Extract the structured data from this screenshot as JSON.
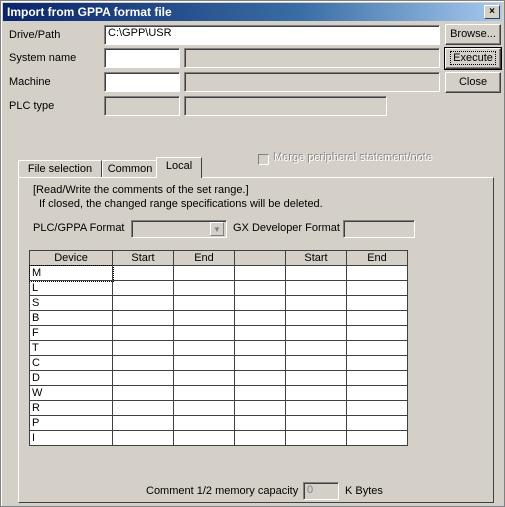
{
  "window": {
    "title": "Import from GPPA format file",
    "close_glyph": "×"
  },
  "labels": {
    "drive_path": "Drive/Path",
    "system_name": "System name",
    "machine": "Machine",
    "plc_type": "PLC type"
  },
  "fields": {
    "drive_path_value": "C:\\GPP\\USR"
  },
  "buttons": {
    "browse": "Browse...",
    "execute": "Execute",
    "close": "Close"
  },
  "checkbox": {
    "merge_label": "Merge peripheral statement/note",
    "checked": false
  },
  "tabs": [
    {
      "label": "File selection"
    },
    {
      "label": "Common"
    },
    {
      "label": "Local"
    }
  ],
  "panel": {
    "note_line1": "[Read/Write the comments of the set range.]",
    "note_line2": "If closed, the changed range specifications will be deleted.",
    "plc_format_label": "PLC/GPPA Format",
    "gx_format_label": "GX Developer Format",
    "capacity_label": "Comment 1/2 memory capacity",
    "capacity_value": "0",
    "capacity_unit": "K Bytes"
  },
  "table": {
    "headers": [
      "Device",
      "Start",
      "End",
      "",
      "Start",
      "End"
    ],
    "devices": [
      "M",
      "L",
      "S",
      "B",
      "F",
      "T",
      "C",
      "D",
      "W",
      "R",
      "P",
      "I"
    ]
  },
  "icons": {
    "combo_arrow": "▼"
  }
}
